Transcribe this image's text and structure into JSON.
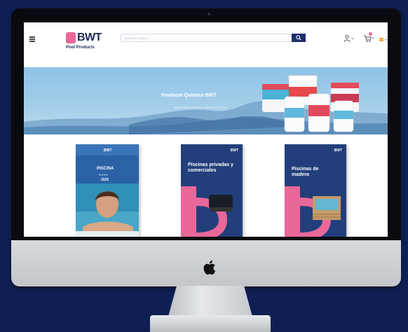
{
  "header": {
    "logo_text": "BWT",
    "logo_subtitle": "Pool Products",
    "search_placeholder": "Empiece a teclear..."
  },
  "banner": {
    "title": "Producto Químico BWT",
    "subtitle": "BWT PROFESSIONAL PRODUCTS USA"
  },
  "catalogs": [
    {
      "title": "PISCINA",
      "subtitle": "TARIFA",
      "year": "2025",
      "brand": "BWT"
    },
    {
      "title": "Piscinas privadas y comerciales",
      "brand": "BWT"
    },
    {
      "title": "Piscinas de madera",
      "brand": "BWT"
    }
  ],
  "colors": {
    "background": "#0f1f54",
    "brand_navy": "#1f2f6b",
    "brand_pink": "#e9689a",
    "banner_sky": "#9ccbe8"
  },
  "icons": [
    "hamburger-icon",
    "search-icon",
    "user-icon",
    "cart-icon",
    "flag-icon",
    "apple-logo-icon"
  ]
}
